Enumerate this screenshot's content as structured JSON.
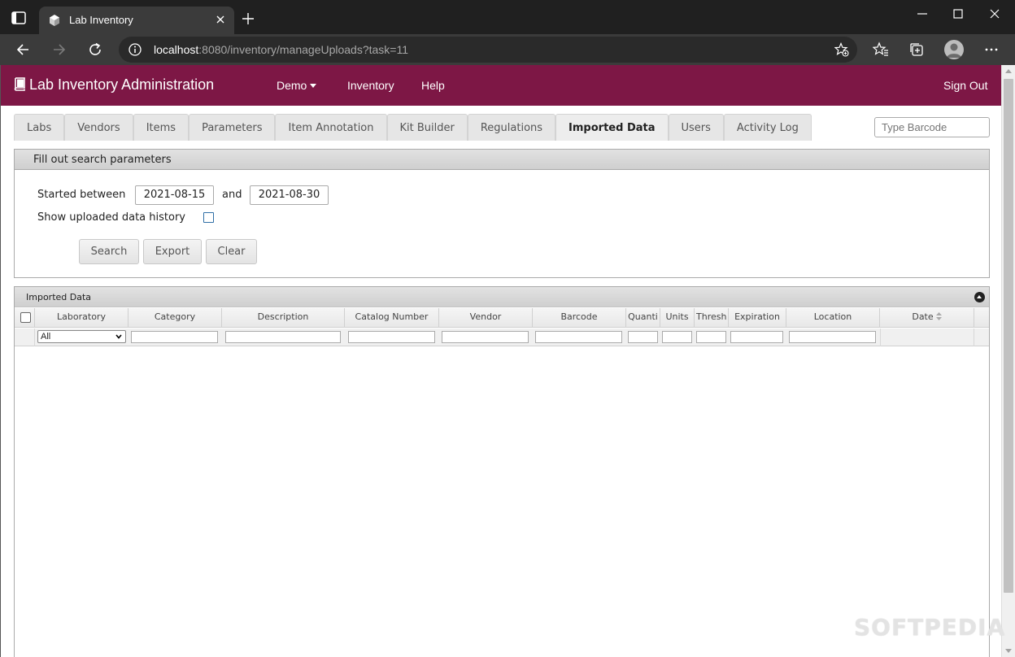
{
  "browser": {
    "tab_title": "Lab Inventory",
    "url_host": "localhost",
    "url_rest": ":8080/inventory/manageUploads?task=11"
  },
  "navbar": {
    "brand": "Lab Inventory Administration",
    "menu_demo": "Demo",
    "menu_inventory": "Inventory",
    "menu_help": "Help",
    "sign_out": "Sign Out",
    "background": "#7d1745"
  },
  "tabs": [
    {
      "label": "Labs",
      "active": false
    },
    {
      "label": "Vendors",
      "active": false
    },
    {
      "label": "Items",
      "active": false
    },
    {
      "label": "Parameters",
      "active": false
    },
    {
      "label": "Item Annotation",
      "active": false
    },
    {
      "label": "Kit Builder",
      "active": false
    },
    {
      "label": "Regulations",
      "active": false
    },
    {
      "label": "Imported Data",
      "active": true
    },
    {
      "label": "Users",
      "active": false
    },
    {
      "label": "Activity Log",
      "active": false
    }
  ],
  "barcode": {
    "placeholder": "Type Barcode",
    "value": ""
  },
  "search_panel": {
    "header": "Fill out search parameters",
    "started_label": "Started between",
    "start_date": "2021-08-15",
    "and_label": "and",
    "end_date": "2021-08-30",
    "history_label": "Show uploaded data history",
    "history_checked": false,
    "buttons": {
      "search": "Search",
      "export": "Export",
      "clear": "Clear"
    }
  },
  "grid": {
    "caption": "Imported Data",
    "columns": [
      "Laboratory",
      "Category",
      "Description",
      "Catalog Number",
      "Vendor",
      "Barcode",
      "Quanti",
      "Units",
      "Thresh",
      "Expiration",
      "Location",
      "Date"
    ],
    "laboratory_filter": "All",
    "rows": []
  },
  "watermark": "SOFTPEDIA",
  "icons": {
    "window_menu": "window-icon",
    "favicon": "cube-icon",
    "back": "back-arrow-icon",
    "forward": "forward-arrow-icon",
    "reload": "reload-icon",
    "site_info": "info-icon",
    "add_favorite": "star-plus-icon",
    "favorites": "favorites-icon",
    "collections": "collections-icon",
    "profile": "profile-icon",
    "more": "more-dots-icon"
  }
}
